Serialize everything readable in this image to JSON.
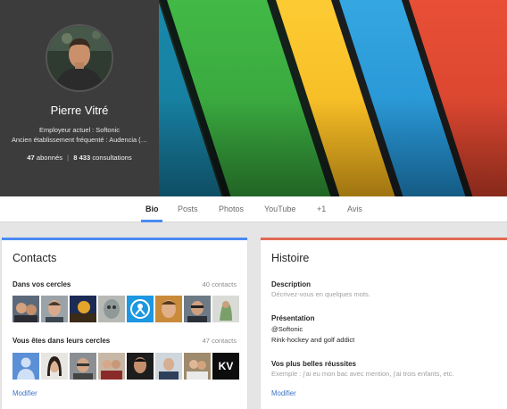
{
  "profile": {
    "name": "Pierre Vitré",
    "employer": "Employeur actuel : Softonic",
    "school": "Ancien établissement fréquenté : Audencia (…",
    "followers_count": "47",
    "followers_label": "abonnés",
    "views_count": "8 433",
    "views_label": "consultations",
    "separator": "|"
  },
  "tabs": [
    {
      "label": "Bio",
      "active": true
    },
    {
      "label": "Posts",
      "active": false
    },
    {
      "label": "Photos",
      "active": false
    },
    {
      "label": "YouTube",
      "active": false
    },
    {
      "label": "+1",
      "active": false
    },
    {
      "label": "Avis",
      "active": false
    }
  ],
  "contacts": {
    "title": "Contacts",
    "in_circles": {
      "label": "Dans vos cercles",
      "count": "40 contacts",
      "avatars": [
        "avatar-photo-1",
        "avatar-photo-2",
        "avatar-photo-3",
        "avatar-photo-4",
        "avatar-logo-blue",
        "avatar-photo-5",
        "avatar-photo-6",
        "avatar-photo-7"
      ]
    },
    "in_their_circles": {
      "label": "Vous êtes dans leurs cercles",
      "count": "47 contacts",
      "avatars": [
        "default-user-icon",
        "avatar-photo-8",
        "avatar-photo-9",
        "avatar-photo-10",
        "avatar-photo-11",
        "avatar-photo-12",
        "avatar-photo-13",
        "avatar-logo-kv"
      ]
    },
    "edit_label": "Modifier",
    "kv_logo_text": "KV"
  },
  "history": {
    "title": "Histoire",
    "description_label": "Description",
    "description_placeholder": "Décrivez-vous en quelques mots.",
    "presentation_label": "Présentation",
    "presentation_lines": [
      "@Softonic",
      "Rink-hockey and golf addict"
    ],
    "achievements_label": "Vos plus belles réussites",
    "achievements_placeholder": "Exemple : j'ai eu mon bac avec mention, j'ai trois enfants, etc.",
    "edit_label": "Modifier"
  },
  "colors": {
    "accent_blue": "#4a8af4",
    "accent_red": "#e06955",
    "link": "#3b73c9"
  }
}
